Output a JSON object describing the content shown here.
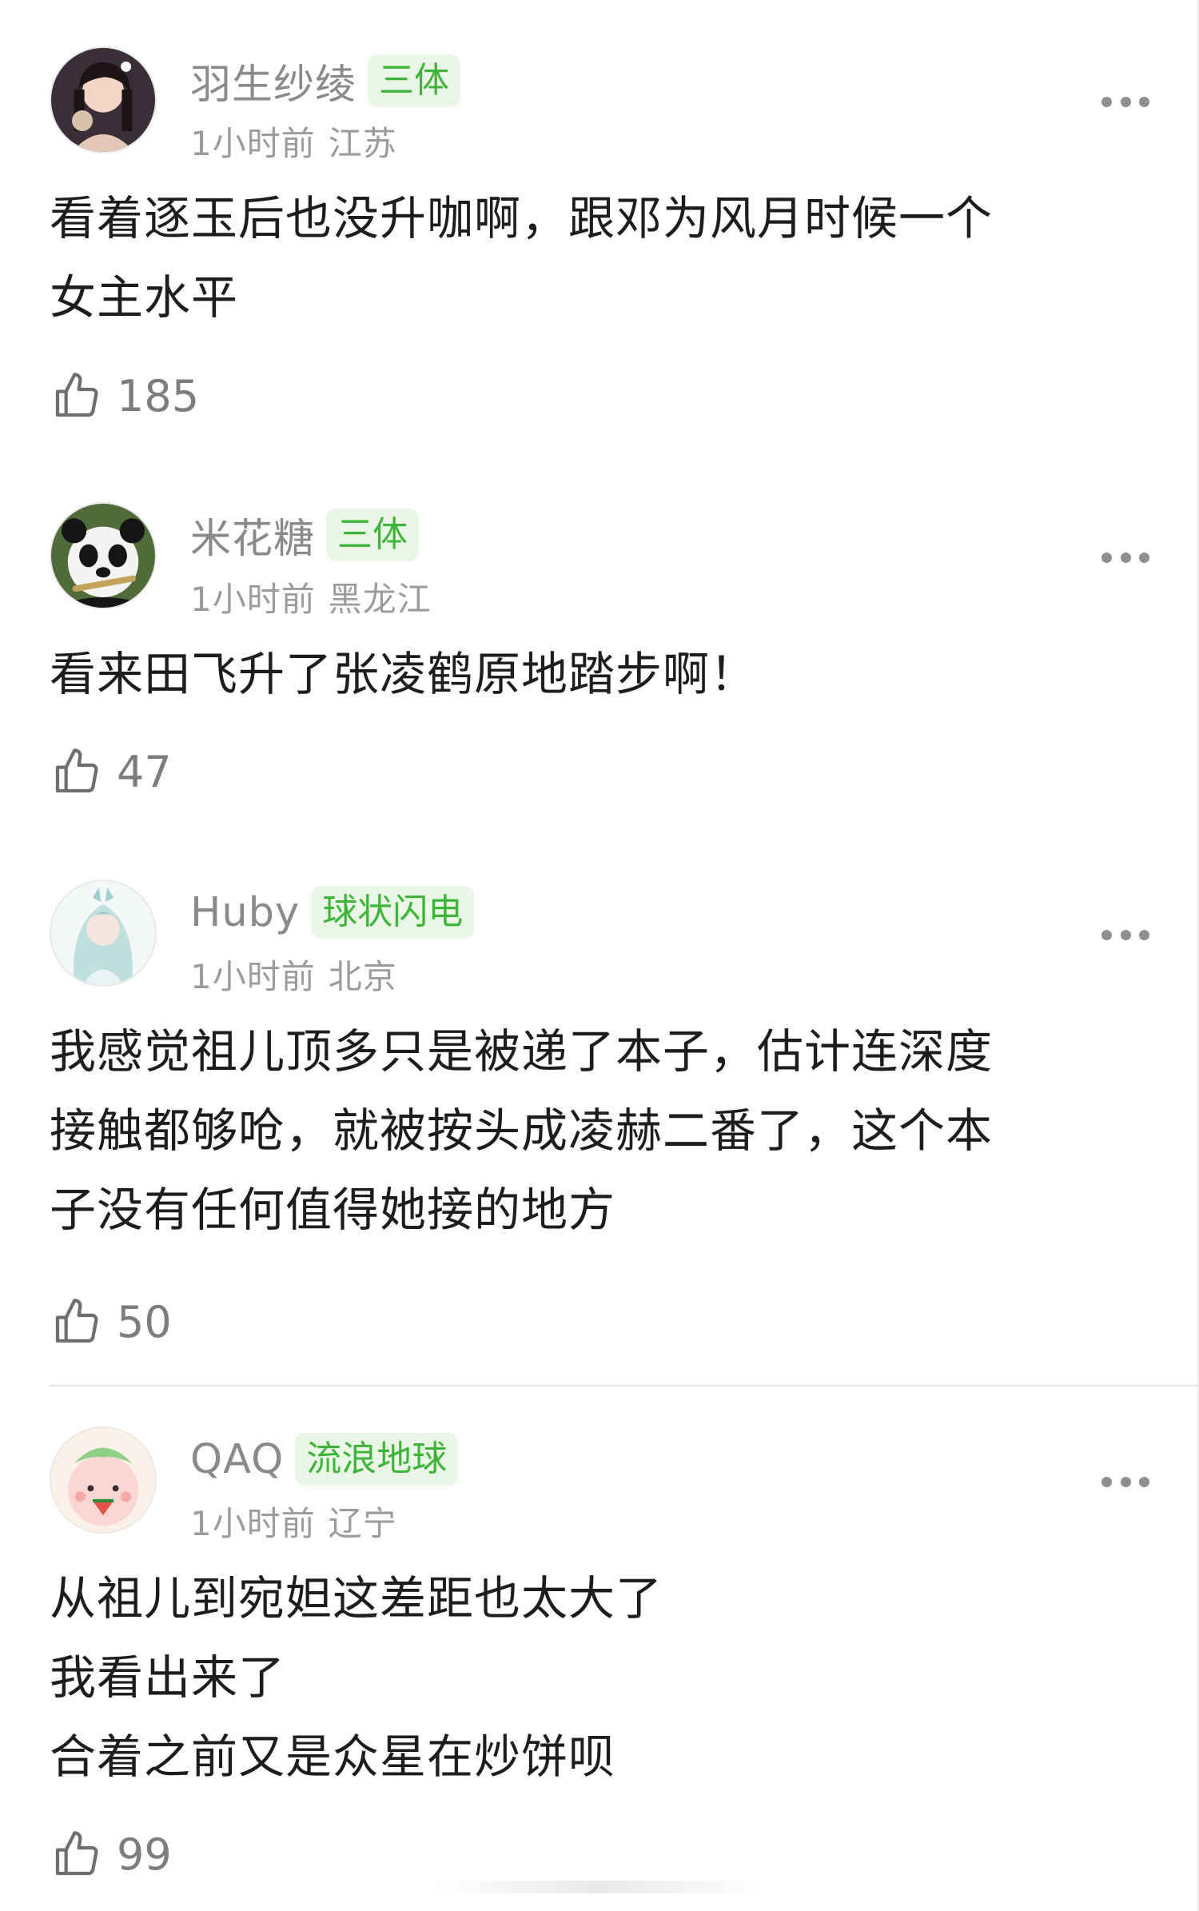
{
  "comments": [
    {
      "username": "羽生纱绫",
      "badge": "三体",
      "time": "1小时前",
      "location": "江苏",
      "lines": [
        "看着逐玉后也没升咖啊，跟邓为风月时候一个",
        "女主水平"
      ],
      "likes": "185",
      "avatar_icon": "avatar-girl-icon"
    },
    {
      "username": "米花糖",
      "badge": "三体",
      "time": "1小时前",
      "location": "黑龙江",
      "lines": [
        "看来田飞升了张凌鹤原地踏步啊！"
      ],
      "likes": "47",
      "avatar_icon": "avatar-panda-icon"
    },
    {
      "username": "Huby",
      "badge": "球状闪电",
      "time": "1小时前",
      "location": "北京",
      "lines": [
        "我感觉祖儿顶多只是被递了本子，估计连深度",
        "接触都够呛，就被按头成凌赫二番了，这个本",
        "子没有任何值得她接的地方"
      ],
      "likes": "50",
      "avatar_icon": "avatar-anime-icon"
    },
    {
      "username": "QAQ",
      "badge": "流浪地球",
      "time": "1小时前",
      "location": "辽宁",
      "lines": [
        "从祖儿到宛妲这差距也太大了",
        "我看出来了",
        "合着之前又是众星在炒饼呗"
      ],
      "likes": "99",
      "avatar_icon": "avatar-pink-cartoon-icon"
    }
  ],
  "colors": {
    "badge_text": "#3fb43a",
    "badge_bg": "#eaf7e7",
    "meta_text": "#9c9c9c",
    "body_text": "#1d1d1d"
  },
  "icons": {
    "like": "thumbs-up-icon",
    "more": "more-dots-icon"
  }
}
